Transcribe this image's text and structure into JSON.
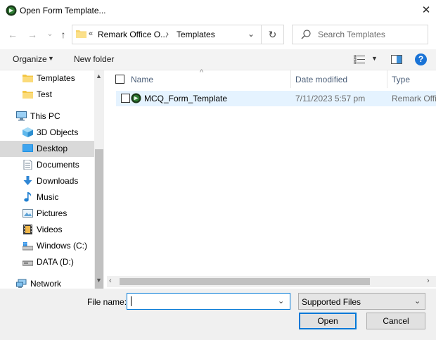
{
  "window": {
    "title": "Open Form Template...",
    "close_glyph": "✕"
  },
  "nav_buttons": {
    "back": "←",
    "forward": "→",
    "recent": "⌄",
    "up": "↑"
  },
  "address_bar": {
    "overflow": "«",
    "crumbs": [
      "Remark Office O...",
      "Templates"
    ],
    "separator": "›",
    "dropdown": "⌄",
    "refresh": "↻"
  },
  "search": {
    "placeholder": "Search Templates"
  },
  "toolbar": {
    "organize": "Organize",
    "organize_arrow": "▼",
    "new_folder": "New folder",
    "view_arrow": "▼",
    "help": "?"
  },
  "nav_pane": {
    "items": [
      {
        "label": "Templates",
        "icon": "folder-icon"
      },
      {
        "label": "Test",
        "icon": "folder-icon"
      },
      {
        "label": "This PC",
        "icon": "computer-icon"
      },
      {
        "label": "3D Objects",
        "icon": "3d-objects-icon"
      },
      {
        "label": "Desktop",
        "icon": "desktop-icon",
        "selected": true
      },
      {
        "label": "Documents",
        "icon": "documents-icon"
      },
      {
        "label": "Downloads",
        "icon": "downloads-icon"
      },
      {
        "label": "Music",
        "icon": "music-icon"
      },
      {
        "label": "Pictures",
        "icon": "pictures-icon"
      },
      {
        "label": "Videos",
        "icon": "videos-icon"
      },
      {
        "label": "Windows  (C:)",
        "icon": "drive-c-icon"
      },
      {
        "label": "DATA (D:)",
        "icon": "drive-d-icon"
      },
      {
        "label": "Network",
        "icon": "network-icon"
      }
    ]
  },
  "file_list": {
    "columns": [
      "Name",
      "Date modified",
      "Type"
    ],
    "sort_glyph": "^",
    "rows": [
      {
        "name": "MCQ_Form_Template",
        "date_modified": "7/11/2023 5:57 pm",
        "type": "Remark Office"
      }
    ]
  },
  "scroll": {
    "up": "▲",
    "down": "▼",
    "left": "‹",
    "right": "›"
  },
  "bottom": {
    "file_name_label": "File name:",
    "file_name_value": "",
    "file_name_dropdown": "⌄",
    "file_type": "Supported Files",
    "file_type_dropdown": "⌄",
    "open_button": "Open",
    "cancel_button": "Cancel"
  },
  "colors": {
    "accent": "#0078d7",
    "selection": "#e5f3ff",
    "nav_selected": "#d9d9d9",
    "header_text": "#4c607a"
  }
}
